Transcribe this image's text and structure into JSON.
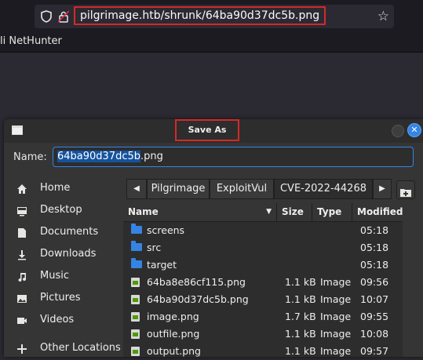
{
  "browser": {
    "url": "pilgrimage.htb/shrunk/64ba90d37dc5b.png",
    "bookmark_label": "li NetHunter"
  },
  "dialog": {
    "title": "Save As",
    "name_label": "Name:",
    "name_selected": "64ba90d37dc5b",
    "name_rest": ".png",
    "close_symbol": "✕"
  },
  "sidebar": {
    "items": [
      {
        "label": "Home",
        "icon": "home-icon"
      },
      {
        "label": "Desktop",
        "icon": "desktop-icon"
      },
      {
        "label": "Documents",
        "icon": "documents-icon"
      },
      {
        "label": "Downloads",
        "icon": "downloads-icon"
      },
      {
        "label": "Music",
        "icon": "music-icon"
      },
      {
        "label": "Pictures",
        "icon": "pictures-icon"
      },
      {
        "label": "Videos",
        "icon": "videos-icon"
      },
      {
        "label": "Other Locations",
        "icon": "plus-icon"
      }
    ]
  },
  "pathbar": {
    "left_arrow": "◀",
    "right_arrow": "▶",
    "crumbs": [
      "Pilgrimage",
      "ExploitVul",
      "CVE-2022-44268"
    ]
  },
  "filelist": {
    "headers": {
      "name": "Name",
      "size": "Size",
      "type": "Type",
      "modified": "Modified"
    },
    "sort_indicator": "▼",
    "rows": [
      {
        "name": "screens",
        "size": "",
        "type": "",
        "modified": "05:18",
        "kind": "folder"
      },
      {
        "name": "src",
        "size": "",
        "type": "",
        "modified": "05:18",
        "kind": "folder"
      },
      {
        "name": "target",
        "size": "",
        "type": "",
        "modified": "05:18",
        "kind": "folder"
      },
      {
        "name": "64ba8e86cf115.png",
        "size": "1.1 kB",
        "type": "Image",
        "modified": "09:56",
        "kind": "image"
      },
      {
        "name": "64ba90d37dc5b.png",
        "size": "1.1 kB",
        "type": "Image",
        "modified": "10:07",
        "kind": "image"
      },
      {
        "name": "image.png",
        "size": "1.7 kB",
        "type": "Image",
        "modified": "09:55",
        "kind": "image"
      },
      {
        "name": "outfile.png",
        "size": "1.1 kB",
        "type": "Image",
        "modified": "10:08",
        "kind": "image"
      },
      {
        "name": "output.png",
        "size": "1.1 kB",
        "type": "Image",
        "modified": "09:57",
        "kind": "image"
      }
    ]
  },
  "colors": {
    "accent": "#3584e4",
    "annotation_red": "#d62828",
    "selection": "#15539e"
  }
}
